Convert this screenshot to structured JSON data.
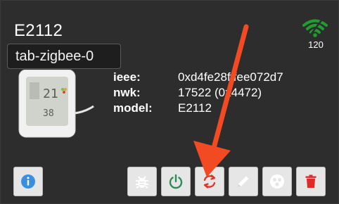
{
  "device": {
    "title": "E2112",
    "tooltip": "tab-zigbee-0",
    "link_quality": "120",
    "properties": [
      {
        "key": "ieee:",
        "value": "0xd4fe28fffee072d7"
      },
      {
        "key": "nwk:",
        "value": "17522 (0x4472)"
      },
      {
        "key": "model:",
        "value": "E2112"
      }
    ],
    "display": {
      "top_number": "21",
      "bottom_number": "38"
    }
  },
  "buttons": [
    {
      "name": "info-button",
      "icon": "info-icon"
    },
    {
      "name": "debug-button",
      "icon": "bug-icon"
    },
    {
      "name": "power-button",
      "icon": "power-icon"
    },
    {
      "name": "reconfigure-button",
      "icon": "refresh-icon"
    },
    {
      "name": "rename-button",
      "icon": "pencil-icon"
    },
    {
      "name": "bind-button",
      "icon": "circles-icon"
    },
    {
      "name": "delete-button",
      "icon": "trash-icon"
    }
  ],
  "colors": {
    "background": "#2d2d2d",
    "signal": "#1e9e2e",
    "info": "#3b8fe0",
    "power": "#2e8b57",
    "refresh": "#e0332b",
    "delete": "#e02a2a",
    "annotation_arrow": "#f24b24"
  }
}
